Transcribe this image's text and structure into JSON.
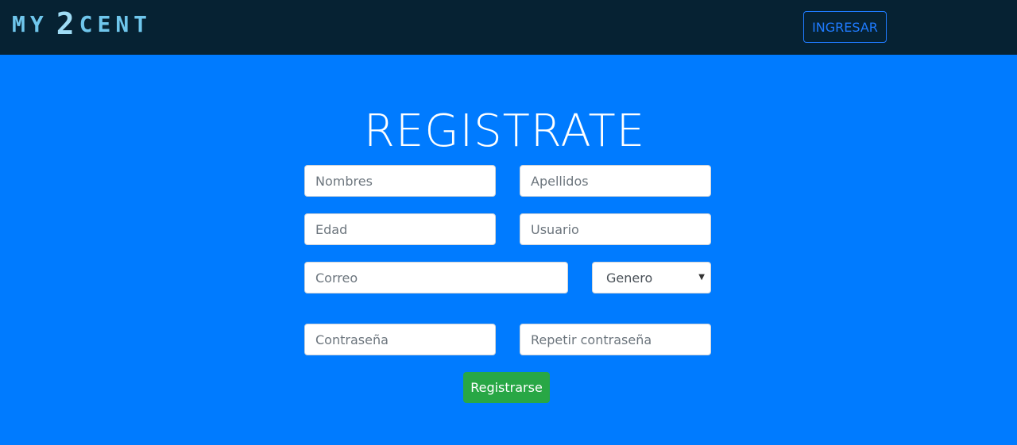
{
  "header": {
    "logo_left": "MY",
    "logo_num": "2",
    "logo_right": "CENT",
    "login_label": "INGRESAR"
  },
  "form": {
    "title": "REGISTRATE",
    "first_name_placeholder": "Nombres",
    "last_name_placeholder": "Apellidos",
    "age_placeholder": "Edad",
    "user_placeholder": "Usuario",
    "email_placeholder": "Correo",
    "gender_selected": "Genero",
    "password_placeholder": "Contraseña",
    "repeat_password_placeholder": "Repetir contraseña",
    "submit_label": "Registrarse"
  },
  "colors": {
    "background": "#007bff",
    "navbar": "#062233",
    "submit": "#28a745"
  }
}
